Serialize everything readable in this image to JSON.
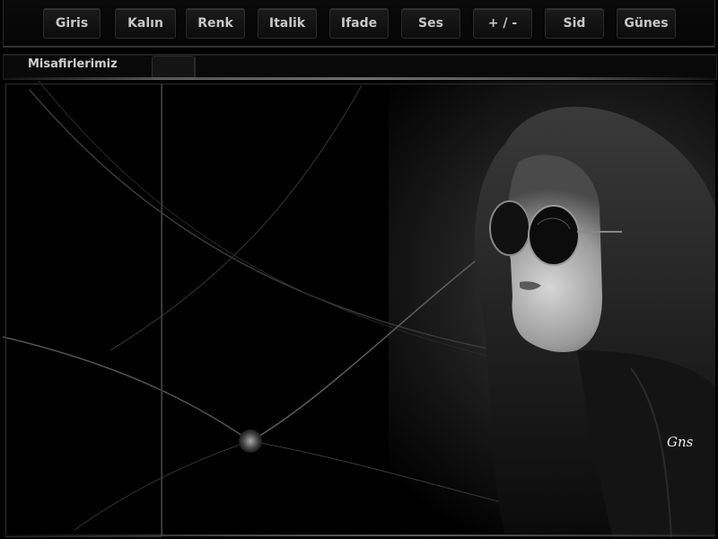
{
  "toolbar": {
    "buttons": [
      {
        "label": "Giris"
      },
      {
        "label": "Kalın"
      },
      {
        "label": "Renk"
      },
      {
        "label": "Italik"
      },
      {
        "label": "Ifade"
      },
      {
        "label": "Ses"
      },
      {
        "label": "+ / -"
      },
      {
        "label": "Sid"
      },
      {
        "label": "Günes"
      }
    ]
  },
  "header": {
    "guests_title": "Misafirlerimiz"
  },
  "main": {
    "signature": "Gns"
  },
  "colors": {
    "background": "#000000",
    "button_text": "#c8c8c8",
    "border": "#2e2e2e"
  }
}
